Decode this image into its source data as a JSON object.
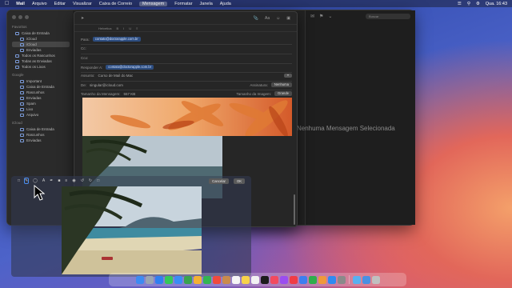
{
  "menubar": {
    "app": "Mail",
    "items": [
      "Arquivo",
      "Editar",
      "Visualizar",
      "Caixa de Correio",
      "Mensagem",
      "Formatar",
      "Janela",
      "Ajuda"
    ],
    "clock": "Qua. 16:43"
  },
  "sidebar": {
    "favorites_head": "Favoritos",
    "items": [
      {
        "label": "Caixa de Entrada",
        "sub": false,
        "active": false
      },
      {
        "label": "iCloud",
        "sub": true,
        "active": false
      },
      {
        "label": "iCloud",
        "sub": true,
        "active": true
      },
      {
        "label": "Enviadas",
        "sub": true,
        "active": false
      },
      {
        "label": "Todos os Rascunhos",
        "sub": false,
        "active": false
      },
      {
        "label": "Todas as Enviadas",
        "sub": false,
        "active": false
      },
      {
        "label": "Todos os Lixos",
        "sub": false,
        "active": false
      }
    ],
    "smart_head": "Google",
    "smart_items": [
      "Important",
      "Caixa de Entrada",
      "Rascunhos",
      "Enviadas",
      "Spam",
      "Lixo",
      "Arquivo"
    ],
    "icloud_head": "iCloud",
    "icloud_items": [
      "Caixa de Entrada",
      "Rascunhos",
      "Enviadas"
    ]
  },
  "viewer": {
    "no_selection": "Nenhuma Mensagem Selecionada",
    "search_placeholder": "Buscar"
  },
  "compose": {
    "to_label": "Para:",
    "to_chip": "contato@doctorapple.com.br",
    "cc_label": "Cc:",
    "bcc_label": "Cco:",
    "reply_label": "Responder A:",
    "reply_chip": "contato@doctorapple.com.br",
    "subject_label": "Assunto:",
    "subject_value": "Curso de Mail do Mac",
    "from_label": "De:",
    "from_value": "singular@icloud.com",
    "signature_label": "Assinatura:",
    "signature_value": "Nenhuma",
    "size_label": "Tamanho da Mensagem:",
    "size_value": "557 KB",
    "image_size_label": "Tamanho da Imagem:",
    "image_size_value": "Grande",
    "format_bar": "Helvetica"
  },
  "markup": {
    "cancel": "Cancelar",
    "ok": "OK"
  },
  "colors": {
    "accent": "#4b8ef0",
    "chip_bg": "#2d4d80"
  },
  "dock": [
    "finder",
    "launchpad",
    "safari",
    "messages",
    "mail",
    "maps",
    "photos",
    "facetime",
    "calendar",
    "contacts",
    "reminders",
    "notes",
    "freeform",
    "tv",
    "music",
    "podcasts",
    "news",
    "keynote",
    "numbers",
    "pages",
    "app-store",
    "settings",
    "preview",
    "downloads",
    "trash"
  ]
}
